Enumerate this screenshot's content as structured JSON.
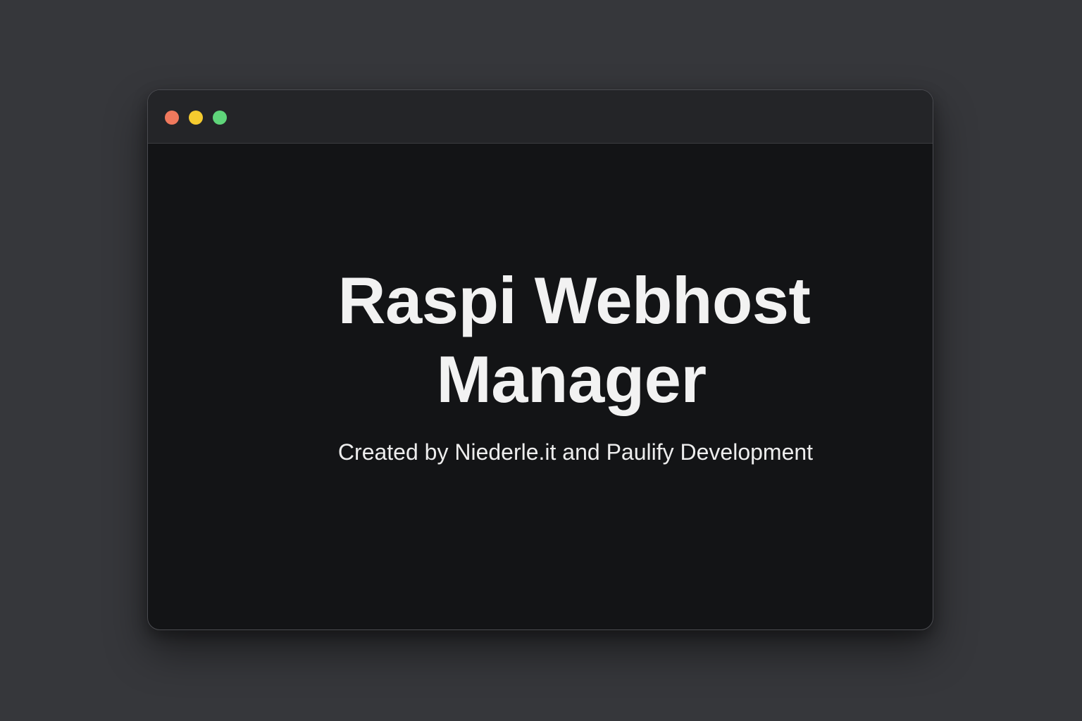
{
  "colors": {
    "desktop": "#36373b",
    "window_body": "#131416",
    "titlebar": "#242528",
    "close": "#f0795d",
    "minimize": "#f5cb2f",
    "maximize": "#5fd57a",
    "text": "#f2f2f2"
  },
  "window": {
    "controls": [
      {
        "name": "close",
        "icon": "close-dot"
      },
      {
        "name": "minimize",
        "icon": "minimize-dot"
      },
      {
        "name": "maximize",
        "icon": "maximize-dot"
      }
    ]
  },
  "main": {
    "title_line1": "Raspi Webhost",
    "title_line2": "Manager",
    "subtitle": "Created by Niederle.it and Paulify Development"
  }
}
